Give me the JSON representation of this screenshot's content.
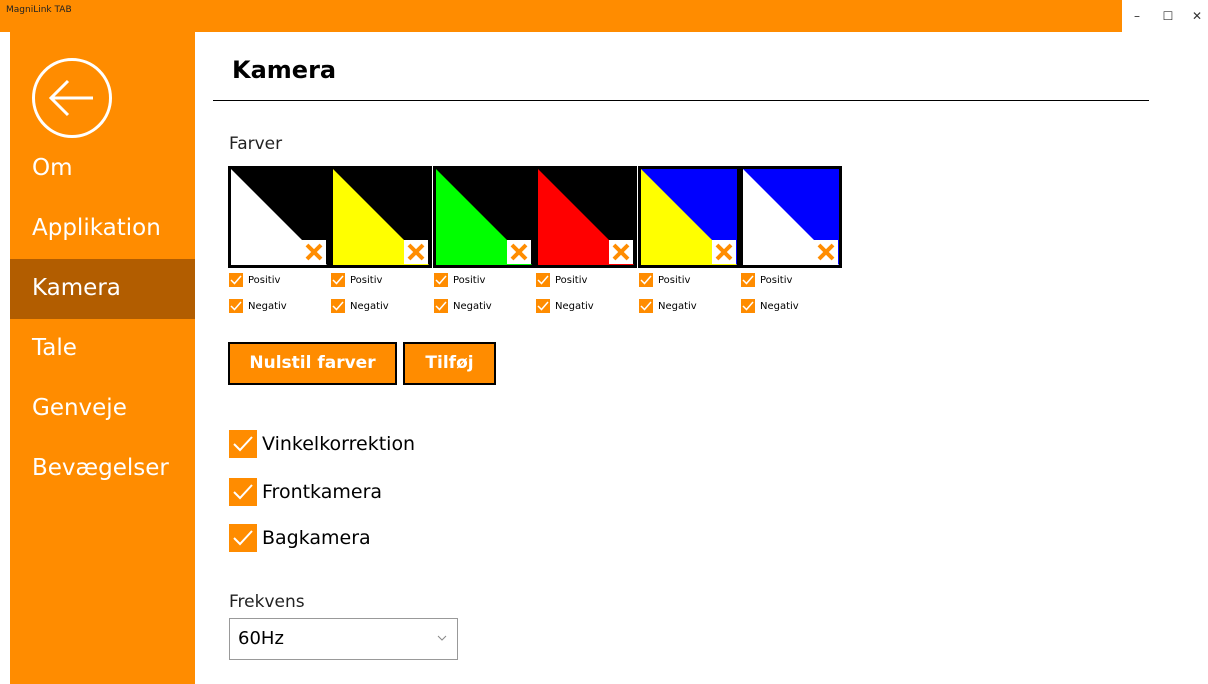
{
  "window": {
    "title": "MagniLink TAB",
    "minimize": "–",
    "maximize": "☐",
    "close": "✕"
  },
  "sidebar": {
    "back_icon": "arrow-left-circle-icon",
    "items": [
      {
        "label": "Om",
        "active": false
      },
      {
        "label": "Applikation",
        "active": false
      },
      {
        "label": "Kamera",
        "active": true
      },
      {
        "label": "Tale",
        "active": false
      },
      {
        "label": "Genveje",
        "active": false
      },
      {
        "label": "Bevægelser",
        "active": false
      }
    ]
  },
  "main": {
    "title": "Kamera",
    "colors_label": "Farver",
    "swatches": [
      {
        "fg": "#ffffff",
        "bg": "#000000",
        "positive": "Positiv",
        "negative": "Negativ",
        "positive_checked": true,
        "negative_checked": true
      },
      {
        "fg": "#ffff00",
        "bg": "#000000",
        "positive": "Positiv",
        "negative": "Negativ",
        "positive_checked": true,
        "negative_checked": true
      },
      {
        "fg": "#00ff00",
        "bg": "#000000",
        "positive": "Positiv",
        "negative": "Negativ",
        "positive_checked": true,
        "negative_checked": true
      },
      {
        "fg": "#ff0000",
        "bg": "#000000",
        "positive": "Positiv",
        "negative": "Negativ",
        "positive_checked": true,
        "negative_checked": true
      },
      {
        "fg": "#ffff00",
        "bg": "#0000ff",
        "positive": "Positiv",
        "negative": "Negativ",
        "positive_checked": true,
        "negative_checked": true
      },
      {
        "fg": "#ffffff",
        "bg": "#0000ff",
        "positive": "Positiv",
        "negative": "Negativ",
        "positive_checked": true,
        "negative_checked": true
      }
    ],
    "reset_button": "Nulstil farver",
    "add_button": "Tilføj",
    "options": [
      {
        "label": "Vinkelkorrektion",
        "checked": true
      },
      {
        "label": "Frontkamera",
        "checked": true
      },
      {
        "label": "Bagkamera",
        "checked": true
      }
    ],
    "frequency_label": "Frekvens",
    "frequency_value": "60Hz"
  },
  "colors": {
    "accent": "#ff8c00",
    "nav_active": "#b25d00"
  }
}
